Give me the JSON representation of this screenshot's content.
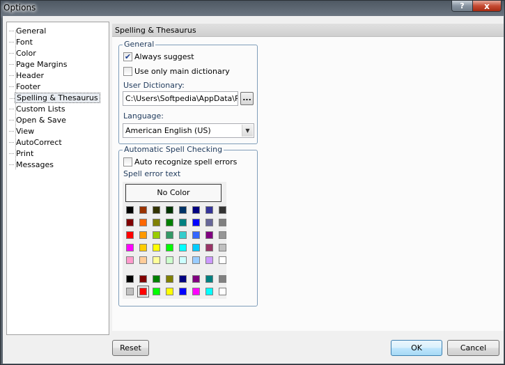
{
  "window": {
    "title": "Options",
    "help_glyph": "?",
    "close_glyph": "x"
  },
  "tree": {
    "items": [
      {
        "label": "General",
        "name": "general"
      },
      {
        "label": "Font",
        "name": "font"
      },
      {
        "label": "Color",
        "name": "color"
      },
      {
        "label": "Page Margins",
        "name": "page-margins"
      },
      {
        "label": "Header",
        "name": "header"
      },
      {
        "label": "Footer",
        "name": "footer"
      },
      {
        "label": "Spelling & Thesaurus",
        "name": "spelling-thesaurus",
        "selected": true
      },
      {
        "label": "Custom Lists",
        "name": "custom-lists"
      },
      {
        "label": "Open & Save",
        "name": "open-save"
      },
      {
        "label": "View",
        "name": "view"
      },
      {
        "label": "AutoCorrect",
        "name": "autocorrect"
      },
      {
        "label": "Print",
        "name": "print"
      },
      {
        "label": "Messages",
        "name": "messages"
      }
    ]
  },
  "pane": {
    "header": "Spelling & Thesaurus",
    "general": {
      "title": "General",
      "always_suggest": {
        "label": "Always suggest",
        "checked": true
      },
      "main_dictionary": {
        "label": "Use only main dictionary",
        "checked": false
      },
      "user_dictionary_label": "User Dictionary:",
      "user_dictionary_value": "C:\\Users\\Softpedia\\AppData\\Roa",
      "browse_label": "...",
      "language_label": "Language:",
      "language_value": "American English (US)"
    },
    "auto_spell": {
      "title": "Automatic Spell Checking",
      "auto_recognize": {
        "label": "Auto recognize spell errors",
        "checked": false
      },
      "error_text_label": "Spell error text",
      "no_color_label": "No Color",
      "palette_rows": [
        [
          "#000000",
          "#993300",
          "#333300",
          "#003300",
          "#003366",
          "#000080",
          "#333399",
          "#333333"
        ],
        [
          "#800000",
          "#ff6600",
          "#808000",
          "#008000",
          "#008080",
          "#0000ff",
          "#666699",
          "#808080"
        ],
        [
          "#ff0000",
          "#ff9900",
          "#99cc00",
          "#339966",
          "#33cccc",
          "#3366ff",
          "#800080",
          "#969696"
        ],
        [
          "#ff00ff",
          "#ffcc00",
          "#ffff00",
          "#00ff00",
          "#00ffff",
          "#00ccff",
          "#993366",
          "#c0c0c0"
        ],
        [
          "#ff99cc",
          "#ffcc99",
          "#ffff99",
          "#ccffcc",
          "#ccffff",
          "#99ccff",
          "#cc99ff",
          "#ffffff"
        ]
      ],
      "recent_rows": [
        [
          "#000000",
          "#800000",
          "#008000",
          "#808000",
          "#000080",
          "#800080",
          "#008080",
          "#808080"
        ],
        [
          "#c0c0c0",
          "#ff0000",
          "#00ff00",
          "#ffff00",
          "#0000ff",
          "#ff00ff",
          "#00ffff",
          "#ffffff"
        ]
      ],
      "selected_swatch": "#ff0000"
    }
  },
  "buttons": {
    "reset": "Reset",
    "ok": "OK",
    "cancel": "Cancel"
  }
}
